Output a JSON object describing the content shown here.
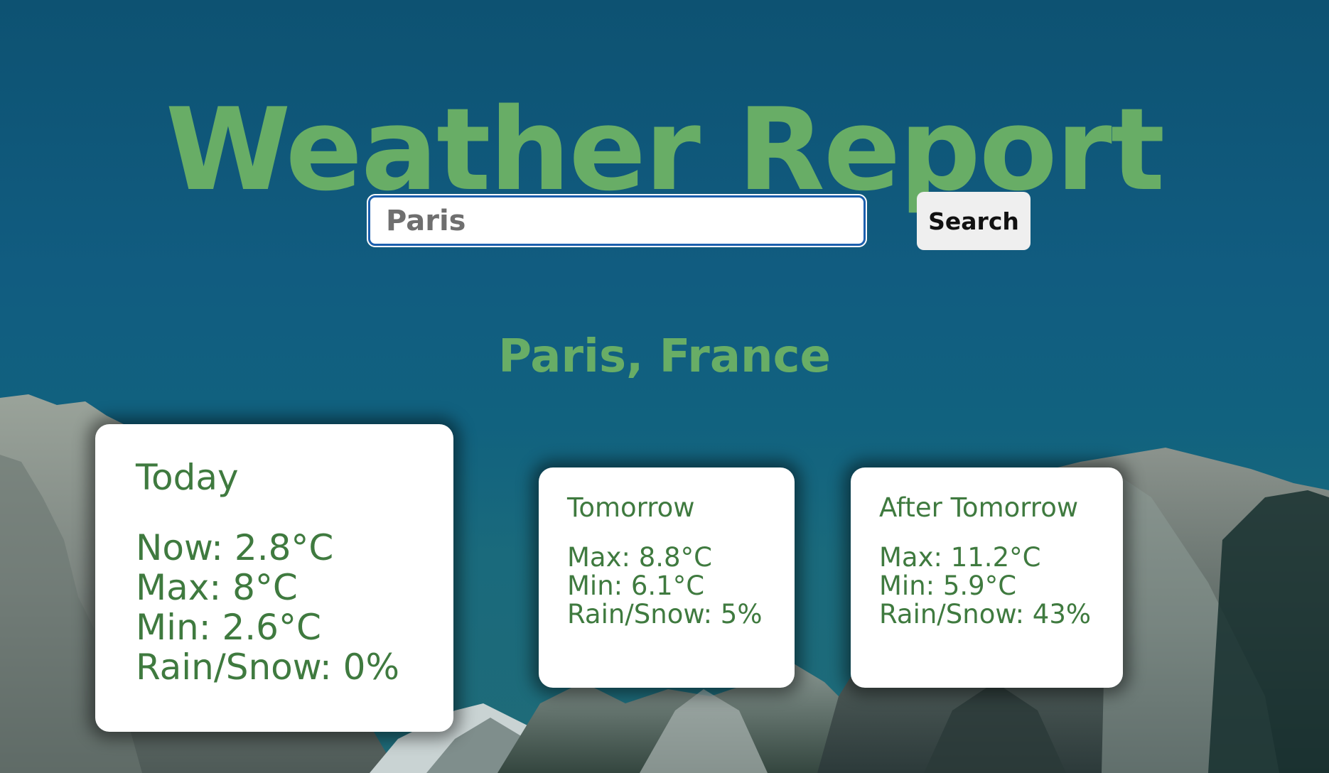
{
  "header": {
    "title": "Weather Report"
  },
  "search": {
    "value": "Paris",
    "button_label": "Search"
  },
  "location": "Paris, France",
  "forecast": {
    "today": {
      "title": "Today",
      "now": "Now: 2.8°C",
      "max": "Max: 8°C",
      "min": "Min: 2.6°C",
      "precip": "Rain/Snow: 0%"
    },
    "tomorrow": {
      "title": "Tomorrow",
      "max": "Max: 8.8°C",
      "min": "Min: 6.1°C",
      "precip": "Rain/Snow: 5%"
    },
    "after_tomorrow": {
      "title": "After Tomorrow",
      "max": "Max: 11.2°C",
      "min": "Min: 5.9°C",
      "precip": "Rain/Snow: 43%"
    }
  },
  "colors": {
    "accent_green": "#68ad66",
    "card_text_green": "#3f7a3f",
    "input_focus_border": "#1c5fae"
  }
}
